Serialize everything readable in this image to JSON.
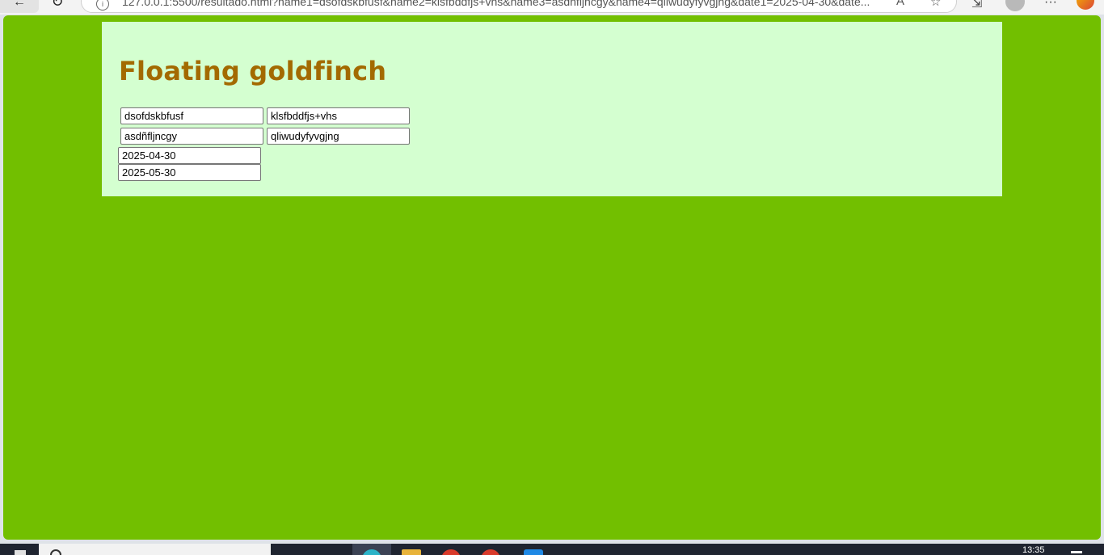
{
  "browser": {
    "url": "127.0.0.1:5500/resultado.html?name1=dsofdskbfusf&name2=klsfbddfjs+vhs&name3=asdñfljncgy&name4=qliwudyfyvgjng&date1=2025-04-30&date...",
    "back_icon": "←",
    "reload_icon": "↻",
    "info_icon": "i",
    "read_aloud_icon": "A",
    "favorite_icon": "☆",
    "split_screen_icon": "⇲",
    "more_icon": "···"
  },
  "page": {
    "title": "Floating goldfinch",
    "fields": {
      "name1": "dsofdskbfusf",
      "name2": "klsfbddfjs+vhs",
      "name3": "asdñfljncgy",
      "name4": "qliwudyfyvgjng",
      "date1": "2025-04-30",
      "date2": "2025-05-30"
    },
    "colors": {
      "background": "#72bf00",
      "panel": "#d4ffd0",
      "title": "#a36a00"
    }
  },
  "taskbar": {
    "clock": "13:35"
  }
}
